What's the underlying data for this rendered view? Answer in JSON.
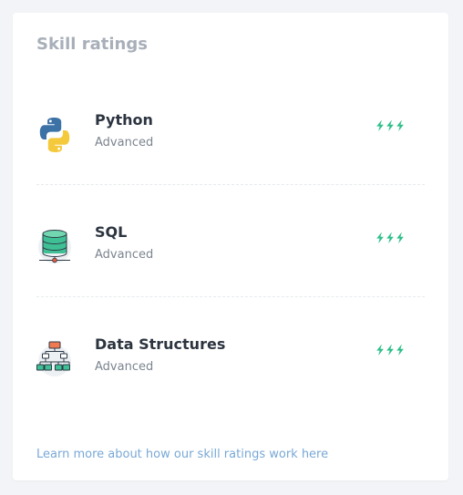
{
  "title": "Skill ratings",
  "accent_color": "#2dbf8a",
  "link_color": "#79a8d6",
  "skills": [
    {
      "name": "Python",
      "level": "Advanced",
      "icon": "python-logo-icon",
      "rating": 3,
      "rating_max": 3
    },
    {
      "name": "SQL",
      "level": "Advanced",
      "icon": "database-icon",
      "rating": 3,
      "rating_max": 3
    },
    {
      "name": "Data Structures",
      "level": "Advanced",
      "icon": "tree-structure-icon",
      "rating": 3,
      "rating_max": 3
    }
  ],
  "footer_link": "Learn more about how our skill ratings work here"
}
